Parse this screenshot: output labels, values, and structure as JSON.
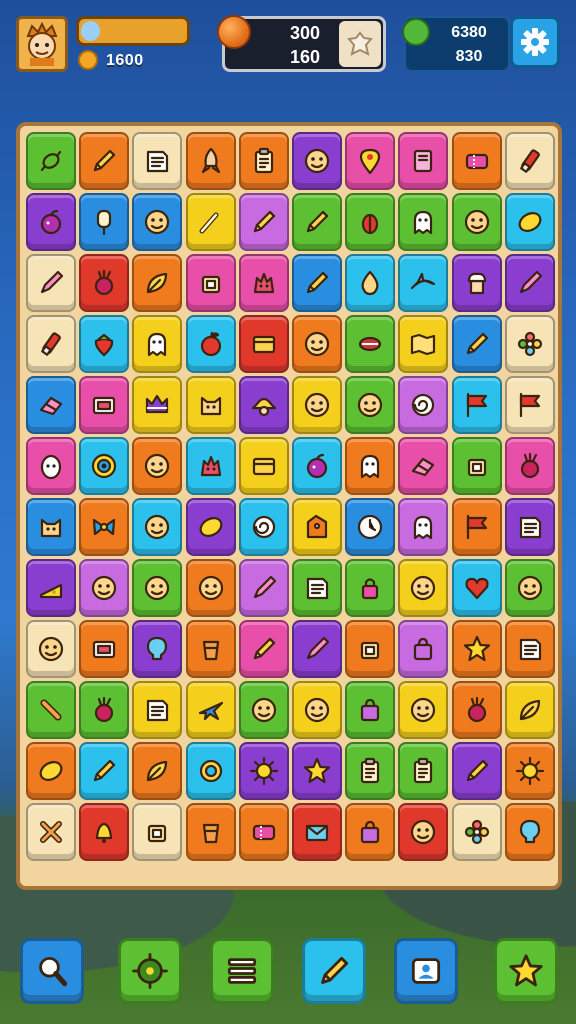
{
  "hud": {
    "level_progress": 0.18,
    "coins": "1600",
    "mid_top": "300",
    "mid_bottom": "160",
    "right_top": "6380",
    "right_bottom": "830"
  },
  "palette": {
    "orange": "#f07a1e",
    "green": "#5cc032",
    "cream": "#f6e3b6",
    "purple": "#8a3ed0",
    "pink": "#e84fa8",
    "red": "#e0392c",
    "yellow": "#f4d01c",
    "blue": "#2a8ee0",
    "cyan": "#2cc0ec",
    "violet": "#c86ae0"
  },
  "board": {
    "rows": [
      [
        [
          "green",
          "candy-icon"
        ],
        [
          "orange",
          "pencil-icon"
        ],
        [
          "cream",
          "note-icon"
        ],
        [
          "orange",
          "rocket-icon"
        ],
        [
          "orange",
          "clipboard-icon"
        ],
        [
          "purple",
          "face-icon"
        ],
        [
          "pink",
          "pin-icon"
        ],
        [
          "pink",
          "book-icon"
        ],
        [
          "orange",
          "ticket-icon"
        ],
        [
          "cream",
          "marker-icon"
        ]
      ],
      [
        [
          "purple",
          "fruit-icon"
        ],
        [
          "blue",
          "popsicle-icon"
        ],
        [
          "blue",
          "face-icon"
        ],
        [
          "yellow",
          "wand-icon"
        ],
        [
          "violet",
          "pencil-icon"
        ],
        [
          "green",
          "pencil-icon"
        ],
        [
          "green",
          "bug-icon"
        ],
        [
          "green",
          "ghost-icon"
        ],
        [
          "green",
          "face-icon"
        ],
        [
          "cyan",
          "lemon-icon"
        ]
      ],
      [
        [
          "cream",
          "pen-icon"
        ],
        [
          "red",
          "radish-icon"
        ],
        [
          "orange",
          "leaf-icon"
        ],
        [
          "pink",
          "box-icon"
        ],
        [
          "pink",
          "monster-icon"
        ],
        [
          "blue",
          "pencil-icon"
        ],
        [
          "cyan",
          "onion-icon"
        ],
        [
          "cyan",
          "shark-icon"
        ],
        [
          "purple",
          "chef-icon"
        ],
        [
          "purple",
          "pen-icon"
        ]
      ],
      [
        [
          "cream",
          "marker-icon"
        ],
        [
          "cyan",
          "strawberry-icon"
        ],
        [
          "yellow",
          "ghost-icon"
        ],
        [
          "cyan",
          "apple-icon"
        ],
        [
          "red",
          "card-icon"
        ],
        [
          "orange",
          "face-icon"
        ],
        [
          "green",
          "mouth-icon"
        ],
        [
          "yellow",
          "map-icon"
        ],
        [
          "blue",
          "pencil-icon"
        ],
        [
          "cream",
          "flower-icon"
        ]
      ],
      [
        [
          "blue",
          "eraser-icon"
        ],
        [
          "pink",
          "tv-icon"
        ],
        [
          "yellow",
          "crown-icon"
        ],
        [
          "yellow",
          "cat-icon"
        ],
        [
          "purple",
          "hat-icon"
        ],
        [
          "yellow",
          "face-icon"
        ],
        [
          "green",
          "face-icon"
        ],
        [
          "violet",
          "swirl-icon"
        ],
        [
          "cyan",
          "flag-icon"
        ],
        [
          "cream",
          "flag-icon"
        ]
      ],
      [
        [
          "pink",
          "egg-icon"
        ],
        [
          "cyan",
          "eye-icon"
        ],
        [
          "orange",
          "face-icon"
        ],
        [
          "cyan",
          "monster-icon"
        ],
        [
          "yellow",
          "card-icon"
        ],
        [
          "cyan",
          "fruit-icon"
        ],
        [
          "orange",
          "ghost-icon"
        ],
        [
          "pink",
          "eraser-icon"
        ],
        [
          "green",
          "box-icon"
        ],
        [
          "pink",
          "radish-icon"
        ]
      ],
      [
        [
          "blue",
          "cat-icon"
        ],
        [
          "orange",
          "bow-icon"
        ],
        [
          "cyan",
          "face-icon"
        ],
        [
          "purple",
          "lemon-icon"
        ],
        [
          "cyan",
          "swirl-icon"
        ],
        [
          "yellow",
          "tag-icon"
        ],
        [
          "blue",
          "clock-icon"
        ],
        [
          "violet",
          "ghost-icon"
        ],
        [
          "orange",
          "flag-icon"
        ],
        [
          "purple",
          "note-icon"
        ]
      ],
      [
        [
          "purple",
          "cheese-icon"
        ],
        [
          "violet",
          "face-icon"
        ],
        [
          "green",
          "face-icon"
        ],
        [
          "orange",
          "face-icon"
        ],
        [
          "violet",
          "pen-icon"
        ],
        [
          "green",
          "note-icon"
        ],
        [
          "green",
          "lock-icon"
        ],
        [
          "yellow",
          "face-icon"
        ],
        [
          "cyan",
          "heart-icon"
        ],
        [
          "green",
          "face-icon"
        ]
      ],
      [
        [
          "cream",
          "face-icon"
        ],
        [
          "orange",
          "tv-icon"
        ],
        [
          "purple",
          "bulb-icon"
        ],
        [
          "orange",
          "cup-icon"
        ],
        [
          "pink",
          "pencil-icon"
        ],
        [
          "purple",
          "pen-icon"
        ],
        [
          "orange",
          "box-icon"
        ],
        [
          "violet",
          "bag-icon"
        ],
        [
          "orange",
          "star-icon"
        ],
        [
          "orange",
          "note-icon"
        ]
      ],
      [
        [
          "green",
          "bone-icon"
        ],
        [
          "green",
          "radish-icon"
        ],
        [
          "yellow",
          "note-icon"
        ],
        [
          "yellow",
          "plane-icon"
        ],
        [
          "green",
          "face-icon"
        ],
        [
          "yellow",
          "face-icon"
        ],
        [
          "green",
          "bag-icon"
        ],
        [
          "yellow",
          "face-icon"
        ],
        [
          "orange",
          "radish-icon"
        ],
        [
          "yellow",
          "leaf-icon"
        ]
      ],
      [
        [
          "orange",
          "lemon-icon"
        ],
        [
          "cyan",
          "pencil-icon"
        ],
        [
          "orange",
          "leaf-icon"
        ],
        [
          "cyan",
          "ring-icon"
        ],
        [
          "purple",
          "sun-icon"
        ],
        [
          "purple",
          "star-icon"
        ],
        [
          "green",
          "clipboard-icon"
        ],
        [
          "green",
          "clipboard-icon"
        ],
        [
          "purple",
          "pencil-icon"
        ],
        [
          "orange",
          "sun-icon"
        ]
      ],
      [
        [
          "cream",
          "cross-icon"
        ],
        [
          "red",
          "bell-icon"
        ],
        [
          "cream",
          "box-icon"
        ],
        [
          "orange",
          "cup-icon"
        ],
        [
          "orange",
          "ticket-icon"
        ],
        [
          "red",
          "envelope-icon"
        ],
        [
          "orange",
          "bag-icon"
        ],
        [
          "red",
          "face-icon"
        ],
        [
          "cream",
          "flower-icon"
        ],
        [
          "orange",
          "bulb-icon"
        ]
      ]
    ]
  },
  "bottom_bar": [
    {
      "name": "search-button",
      "color": "#2a8ee0",
      "icon": "search-icon"
    },
    {
      "name": "gear-button",
      "color": "#5cc032",
      "icon": "gear-icon"
    },
    {
      "name": "list-button",
      "color": "#5cc032",
      "icon": "list-icon"
    },
    {
      "name": "edit-button",
      "color": "#2cc0ec",
      "icon": "pencil-icon"
    },
    {
      "name": "profile-button",
      "color": "#2a8ee0",
      "icon": "profile-icon"
    },
    {
      "name": "star-button",
      "color": "#5cc032",
      "icon": "star-icon"
    }
  ]
}
